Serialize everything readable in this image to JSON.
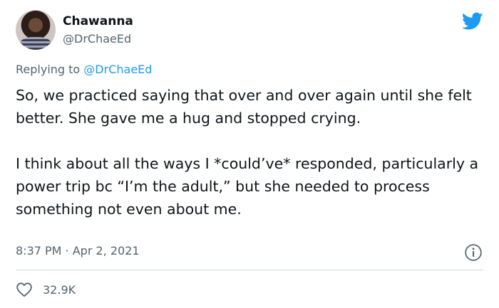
{
  "author": {
    "name": "Chawanna",
    "handle": "@DrChaeEd"
  },
  "reply": {
    "prefix": "Replying to ",
    "mention": "@DrChaeEd"
  },
  "tweet": {
    "paragraphs": [
      "So, we practiced saying that over and over again until she felt better. She gave me a hug and stopped crying.",
      "I think about all the ways I *could’ve* responded, particularly a power trip bc “I’m the adult,” but she needed to process something not even about me."
    ],
    "timestamp": "8:37 PM · Apr 2, 2021"
  },
  "engagement": {
    "likes": "32.9K"
  },
  "colors": {
    "accent": "#1d9bf0",
    "secondary_text": "#536471",
    "primary_text": "#0f1419",
    "divider": "#cfd9de"
  },
  "icons": {
    "logo": "twitter-bird-icon",
    "info": "info-icon",
    "like": "heart-icon"
  }
}
